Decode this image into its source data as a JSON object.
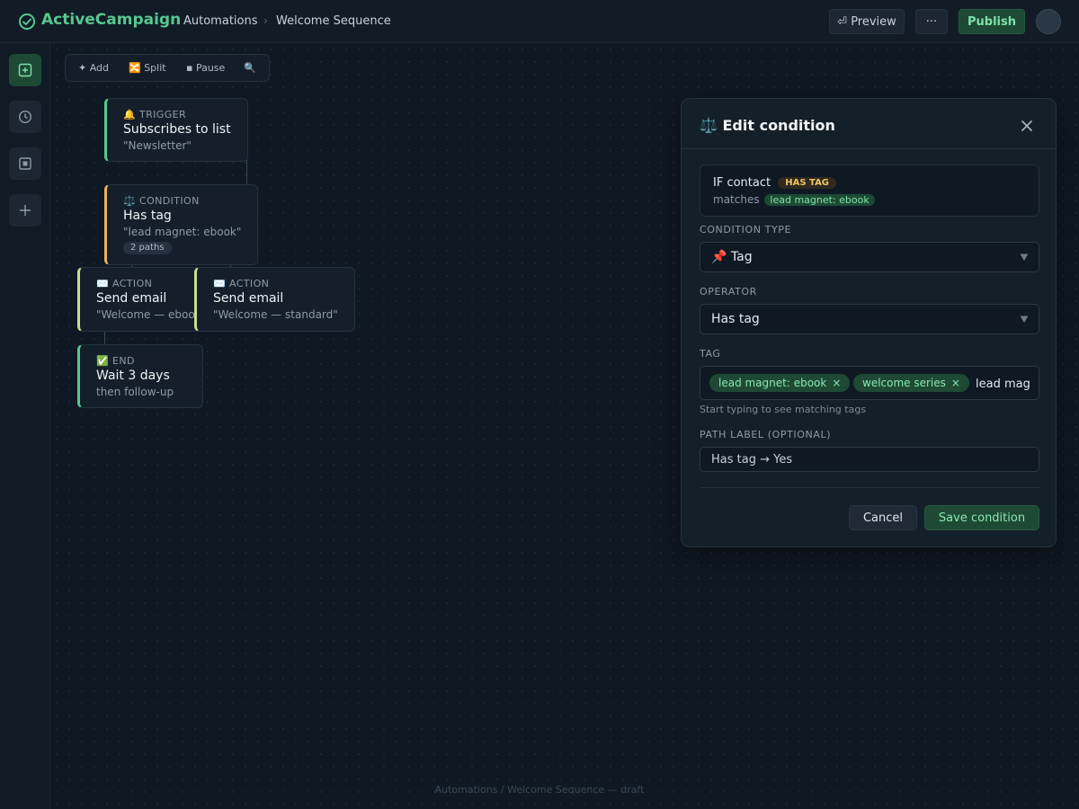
{
  "header": {
    "brand": "ActiveCampaign",
    "breadcrumb": [
      "Automations",
      "Welcome Sequence"
    ],
    "breadcrumb_separator": "›",
    "preview_label": "⏎ Preview",
    "more_label": "···",
    "publish_label": "Publish"
  },
  "rail": {
    "items": [
      "add-node-icon",
      "clock-icon",
      "square-icon",
      "plus-icon"
    ]
  },
  "toolbar": {
    "add_label": "✦ Add",
    "split_label": "🔀 Split",
    "pause_label": "▪ Pause",
    "search_label": "🔍"
  },
  "nodes": {
    "trigger": {
      "kind": "🔔 TRIGGER",
      "title": "Subscribes to list",
      "sub": "\"Newsletter\"",
      "accent": "#58c78f"
    },
    "condition": {
      "kind": "⚖️ CONDITION",
      "title": "Has tag",
      "sub": "\"lead magnet: ebook\"",
      "badge": "2 paths",
      "accent": "#e9b35c"
    },
    "action_yes": {
      "kind": "✉️ ACTION",
      "title": "Send email",
      "sub": "\"Welcome — ebook\"",
      "accent": "#c7e089"
    },
    "action_no": {
      "kind": "✉️ ACTION",
      "title": "Send email",
      "sub": "\"Welcome — standard\"",
      "accent": "#c7e089"
    },
    "end": {
      "kind": "✅ END",
      "title": "Wait 3 days",
      "sub": "then follow-up",
      "accent": "#58c78f"
    }
  },
  "footer_note": "Automations / Welcome Sequence — draft",
  "panel": {
    "title": "⚖️ Edit condition",
    "summary": {
      "prefix": "IF contact",
      "operator_badge": "HAS TAG",
      "matches_label": "matches",
      "tag_badge": "lead magnet: ebook"
    },
    "condition_type": {
      "label": "CONDITION TYPE",
      "value": "📌 Tag"
    },
    "operator": {
      "label": "OPERATOR",
      "value": "Has tag"
    },
    "tag": {
      "label": "TAG",
      "chips": [
        "lead magnet: ebook",
        "welcome series"
      ],
      "chip_remove": "×",
      "input_value": "lead mag",
      "hint": "Start typing to see matching tags"
    },
    "path_label": {
      "label": "PATH LABEL (OPTIONAL)",
      "value": "Has tag → Yes"
    },
    "cancel_label": "Cancel",
    "save_label": "Save condition"
  },
  "colors": {
    "brand": "#58c78f",
    "background": "#0f1923",
    "warning": "#f1c26b"
  }
}
